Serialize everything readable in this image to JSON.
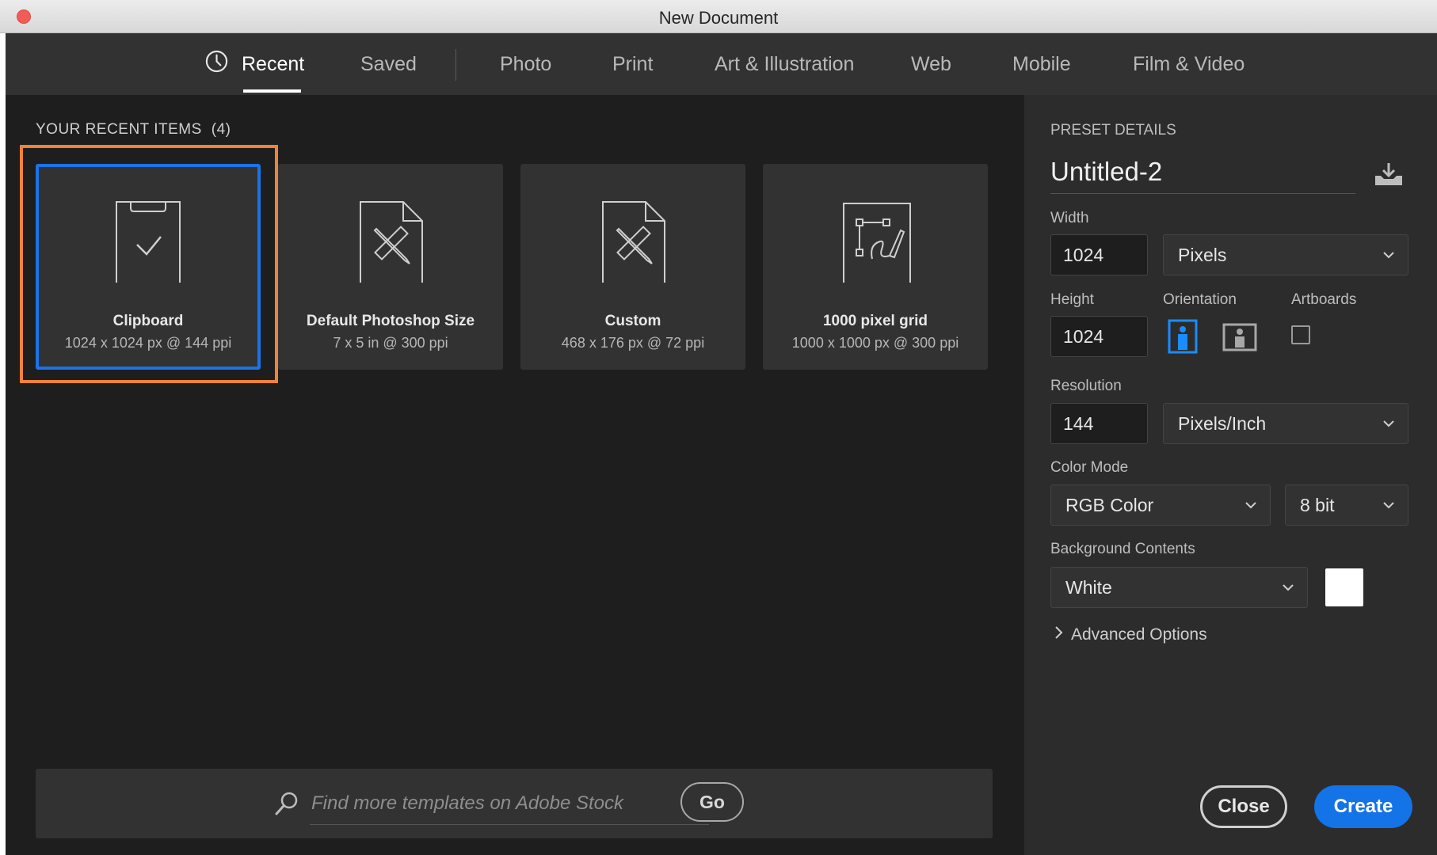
{
  "window": {
    "title": "New Document"
  },
  "tabs": [
    {
      "label": "Recent"
    },
    {
      "label": "Saved"
    },
    {
      "label": "Photo"
    },
    {
      "label": "Print"
    },
    {
      "label": "Art & Illustration"
    },
    {
      "label": "Web"
    },
    {
      "label": "Mobile"
    },
    {
      "label": "Film & Video"
    }
  ],
  "recent": {
    "header": "YOUR RECENT ITEMS",
    "count": "(4)",
    "items": [
      {
        "name": "Clipboard",
        "detail": "1024 x 1024 px @ 144 ppi",
        "icon": "clipboard-icon",
        "selected": true
      },
      {
        "name": "Default Photoshop Size",
        "detail": "7 x 5 in @ 300 ppi",
        "icon": "document-tools-icon"
      },
      {
        "name": "Custom",
        "detail": "468 x 176 px @ 72 ppi",
        "icon": "document-tools-icon"
      },
      {
        "name": "1000 pixel grid",
        "detail": "1000 x 1000 px @ 300 ppi",
        "icon": "artboard-pen-icon"
      }
    ]
  },
  "stock": {
    "placeholder": "Find more templates on Adobe Stock",
    "go_label": "Go"
  },
  "preset": {
    "header": "PRESET DETAILS",
    "name": "Untitled-2",
    "width_label": "Width",
    "width_value": "1024",
    "width_unit": "Pixels",
    "height_label": "Height",
    "height_value": "1024",
    "orientation_label": "Orientation",
    "artboards_label": "Artboards",
    "resolution_label": "Resolution",
    "resolution_value": "144",
    "resolution_unit": "Pixels/Inch",
    "color_mode_label": "Color Mode",
    "color_mode": "RGB Color",
    "bit_depth": "8 bit",
    "background_label": "Background Contents",
    "background": "White",
    "advanced_label": "Advanced Options"
  },
  "actions": {
    "close_label": "Close",
    "create_label": "Create"
  },
  "colors": {
    "accent": "#1473e6",
    "selection_outline": "#1a73e8",
    "highlight": "#f0833a",
    "panel": "#2c2c2c",
    "background": "#1e1e1e"
  }
}
